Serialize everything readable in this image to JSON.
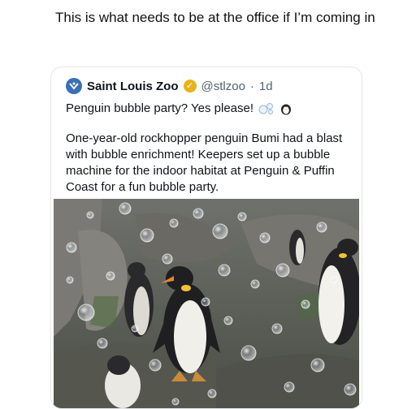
{
  "post": {
    "text": "This is what needs to be at the office if I’m coming in"
  },
  "quote": {
    "display_name": "Saint Louis Zoo",
    "handle": "@stlzoo",
    "separator": "·",
    "time": "1d",
    "line1": "Penguin bubble party? Yes please!",
    "body": "One-year-old rockhopper penguin Bumi had a blast with bubble enrichment! Keepers set up a bubble machine for the indoor habitat at Penguin & Puffin Coast for a fun bubble party."
  },
  "icons": {
    "avatar": "zoo-logo-icon",
    "verified": "verified-badge-icon",
    "bubbles": "bubbles-emoji-icon",
    "penguin": "penguin-emoji-icon"
  },
  "colors": {
    "verified_badge": "#e8b21a",
    "handle_text": "#536471",
    "card_border": "#e3e6e8"
  }
}
